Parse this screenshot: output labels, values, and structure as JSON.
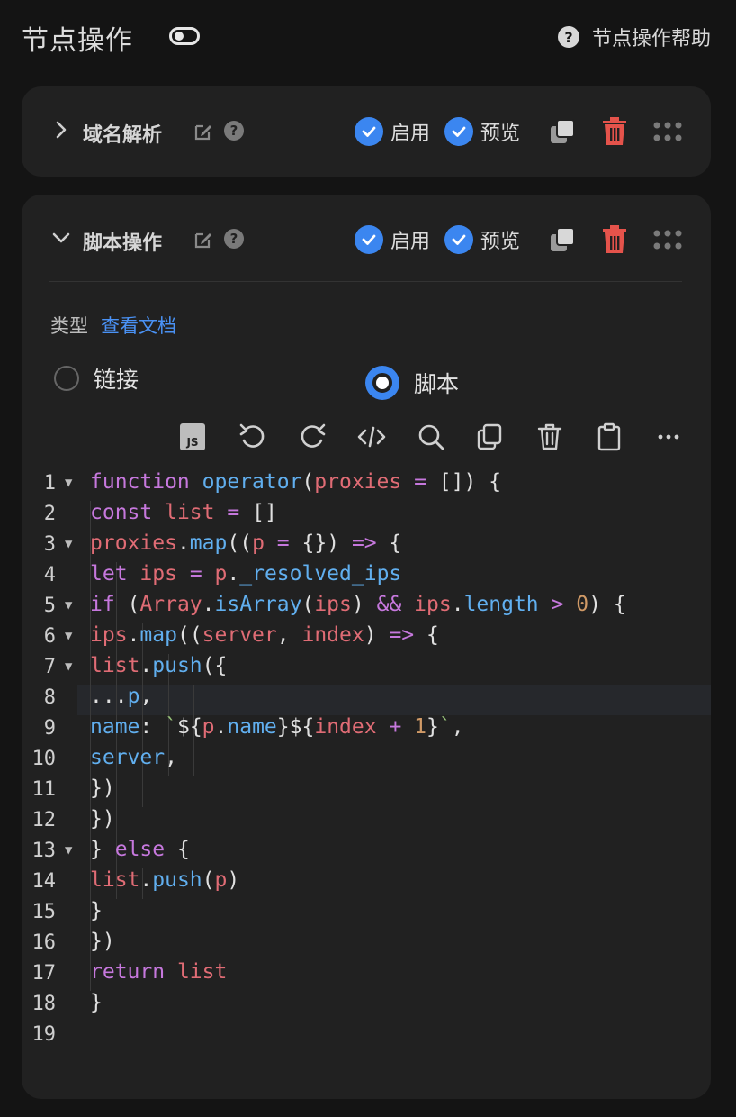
{
  "header": {
    "title": "节点操作",
    "help_label": "节点操作帮助"
  },
  "operations": [
    {
      "title": "域名解析",
      "enable_label": "启用",
      "preview_label": "预览",
      "expanded": false
    },
    {
      "title": "脚本操作",
      "enable_label": "启用",
      "preview_label": "预览",
      "expanded": true
    }
  ],
  "script": {
    "type_label": "类型",
    "doc_link": "查看文档",
    "options": [
      "链接",
      "脚本"
    ],
    "selected": "脚本"
  },
  "toolbar": {
    "icons": [
      "js-file-icon",
      "undo-icon",
      "redo-icon",
      "code-icon",
      "search-icon",
      "copy-icon",
      "trash-icon",
      "clipboard-icon",
      "more-icon"
    ]
  },
  "editor": {
    "line_numbers": [
      "1",
      "2",
      "3",
      "4",
      "5",
      "6",
      "7",
      "8",
      "9",
      "10",
      "11",
      "12",
      "13",
      "14",
      "15",
      "16",
      "17",
      "18",
      "19"
    ],
    "lines": [
      "function operator(proxies = []) {",
      "  const list = []",
      "  proxies.map((p = {}) => {",
      "    let ips = p._resolved_ips",
      "    if (Array.isArray(ips) && ips.length > 0) {",
      "      ips.map((server, index) => {",
      "        list.push({",
      "          ...p,",
      "          name: `${p.name}${index + 1}`,",
      "          server,",
      "        })",
      "      })",
      "    } else {",
      "      list.push(p)",
      "    }",
      "  })",
      "  return list",
      "}",
      ""
    ],
    "highlighted_line": 8
  },
  "colors": {
    "accent": "#3b86f0",
    "danger": "#e5534b",
    "card_bg": "#212121",
    "page_bg": "#141414"
  }
}
